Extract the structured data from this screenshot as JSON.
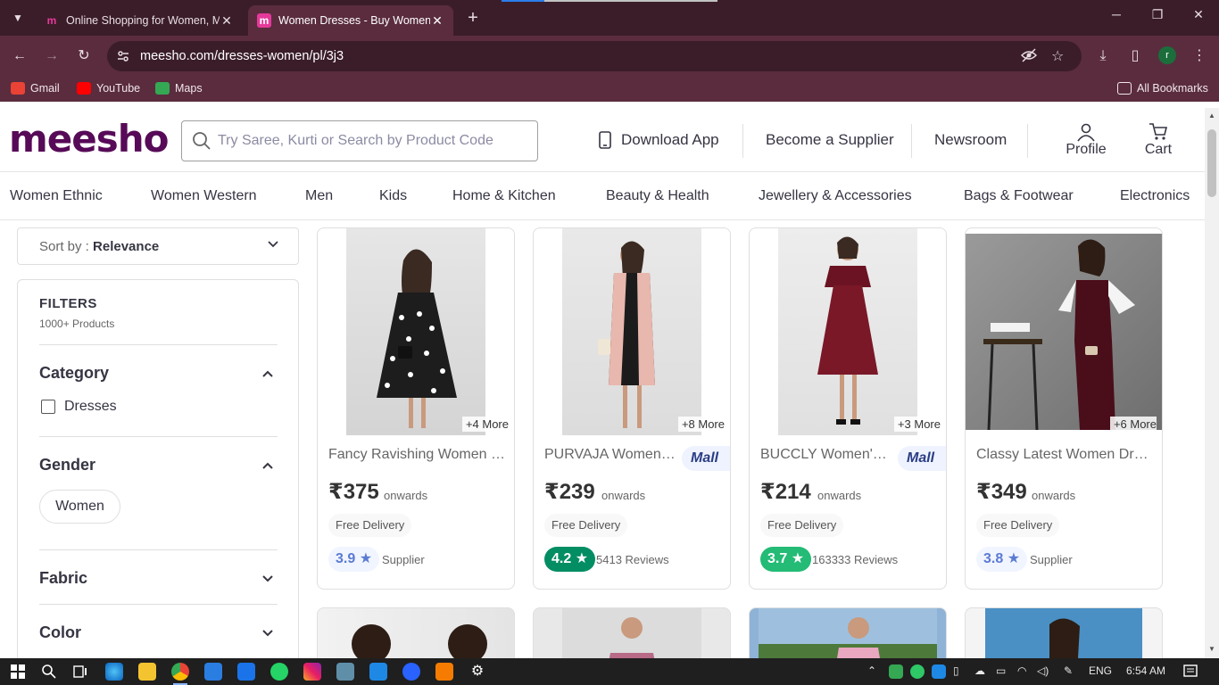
{
  "browser": {
    "tabs": [
      {
        "title": "Online Shopping for Women, M",
        "favicon": "meesho-m-icon"
      },
      {
        "title": "Women Dresses - Buy Women D",
        "favicon": "meesho-m-icon"
      }
    ],
    "new_tab": "+",
    "url": "meesho.com/dresses-women/pl/3j3",
    "profile_initial": "r",
    "bookmarks": [
      "Gmail",
      "YouTube",
      "Maps"
    ],
    "all_bookmarks": "All Bookmarks"
  },
  "header": {
    "logo": "meesho",
    "search_placeholder": "Try Saree, Kurti or Search by Product Code",
    "download_app": "Download App",
    "become_supplier": "Become a Supplier",
    "newsroom": "Newsroom",
    "profile": "Profile",
    "cart": "Cart"
  },
  "categories": [
    "Women Ethnic",
    "Women Western",
    "Men",
    "Kids",
    "Home & Kitchen",
    "Beauty & Health",
    "Jewellery & Accessories",
    "Bags & Footwear",
    "Electronics"
  ],
  "sort": {
    "label": "Sort by : ",
    "value": "Relevance"
  },
  "filters": {
    "title": "FILTERS",
    "count": "1000+ Products",
    "sections": [
      {
        "name": "Category",
        "options": [
          "Dresses"
        ]
      },
      {
        "name": "Gender",
        "options": [
          "Women"
        ]
      },
      {
        "name": "Fabric"
      },
      {
        "name": "Color"
      }
    ]
  },
  "products": [
    {
      "name": "Fancy Ravishing Women Dresses",
      "more": "+4 More",
      "price": "₹375",
      "onwards": "onwards",
      "delivery": "Free Delivery",
      "rating": "3.9 ★",
      "reviews": "Supplier",
      "mall": ""
    },
    {
      "name": "PURVAJA Women Dresses",
      "more": "+8 More",
      "price": "₹239",
      "onwards": "onwards",
      "delivery": "Free Delivery",
      "rating": "4.2 ★",
      "reviews": "5413 Reviews",
      "mall": "Mall"
    },
    {
      "name": "BUCCLY Women's Dresses",
      "more": "+3 More",
      "price": "₹214",
      "onwards": "onwards",
      "delivery": "Free Delivery",
      "rating": "3.7 ★",
      "reviews": "163333 Reviews",
      "mall": "Mall"
    },
    {
      "name": "Classy Latest Women Dresses",
      "more": "+6 More",
      "price": "₹349",
      "onwards": "onwards",
      "delivery": "Free Delivery",
      "rating": "3.8 ★",
      "reviews": "Supplier",
      "mall": ""
    }
  ],
  "taskbar": {
    "lang": "ENG",
    "time": "6:54 AM"
  },
  "colors": {
    "brand": "#570a57",
    "chrome": "#5a2c3e",
    "rating_green": "#23bb75",
    "rating_dark_green": "#038d63"
  }
}
